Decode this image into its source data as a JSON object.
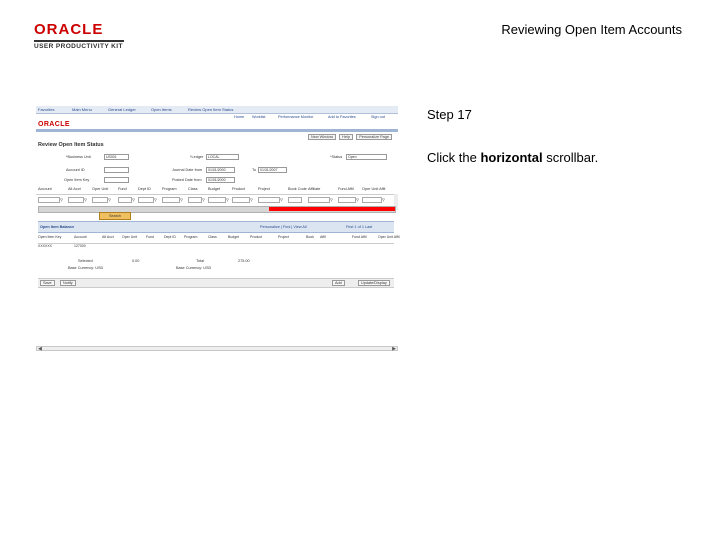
{
  "header": {
    "logo_primary": "ORACLE",
    "logo_secondary": "USER PRODUCTIVITY KIT",
    "title": "Reviewing Open Item Accounts"
  },
  "step": {
    "label": "Step 17",
    "instruction_prefix": "Click the ",
    "instruction_bold": "horizontal",
    "instruction_suffix": " scrollbar."
  },
  "screenshot": {
    "top_links": [
      "Favorites",
      "Main Menu",
      "General Ledger",
      "Open Items",
      "Review Open Item Status"
    ],
    "home_links": [
      "Home",
      "Worklist",
      "Performance Monitor",
      "Add to Favorites",
      "Sign out"
    ],
    "brand": "ORACLE",
    "right_buttons": [
      "New Window",
      "Help",
      "Personalize Page"
    ],
    "page_title": "Review Open Item Status",
    "form": {
      "business_unit_label": "*Business Unit",
      "business_unit_value": "US001",
      "ledger_label": "*Ledger",
      "ledger_value": "LOCAL",
      "status_label": "*Status",
      "status_value": "Open",
      "account_label": "Account ID",
      "journal_date_label": "Journal Date from",
      "journal_date_value": "01/01/2000",
      "to_label": "To",
      "to_value": "01/31/2007",
      "open_item_key_label": "Open Item Key",
      "posted_date_label": "Posted Date from",
      "posted_date_value": "01/01/2000"
    },
    "columns": [
      "Account",
      "Alt Acct",
      "Oper Unit",
      "Fund",
      "Dept ID",
      "Program",
      "Class",
      "Budget",
      "Product",
      "Project",
      "Book Code",
      "Affiliate",
      "Fund Affil",
      "Oper Unit Affil"
    ],
    "search_button": "Search",
    "grid": {
      "title": "Open Item Balance",
      "controls": "Personalize | Find | View All",
      "pager": "First 1 of 1 Last",
      "columns": [
        "Open Item Key",
        "Account",
        "Alt Acct",
        "Oper Unit",
        "Fund",
        "Dept ID",
        "Program",
        "Class",
        "Budget",
        "Product",
        "Project",
        "Book",
        "Affil",
        "Fund Affil",
        "Oper Unit Affil"
      ],
      "row": [
        "XXXXXX",
        "127000"
      ]
    },
    "totals": {
      "selected_label": "Selected",
      "selected_value": "0.00",
      "selected_currency": "Base Currency: USD",
      "total_label": "Total",
      "total_value": "275.00",
      "total_currency": "Base Currency: USD"
    },
    "buttons": {
      "save": "Save",
      "notify": "Notify",
      "add": "Add",
      "update": "Update/Display"
    }
  }
}
